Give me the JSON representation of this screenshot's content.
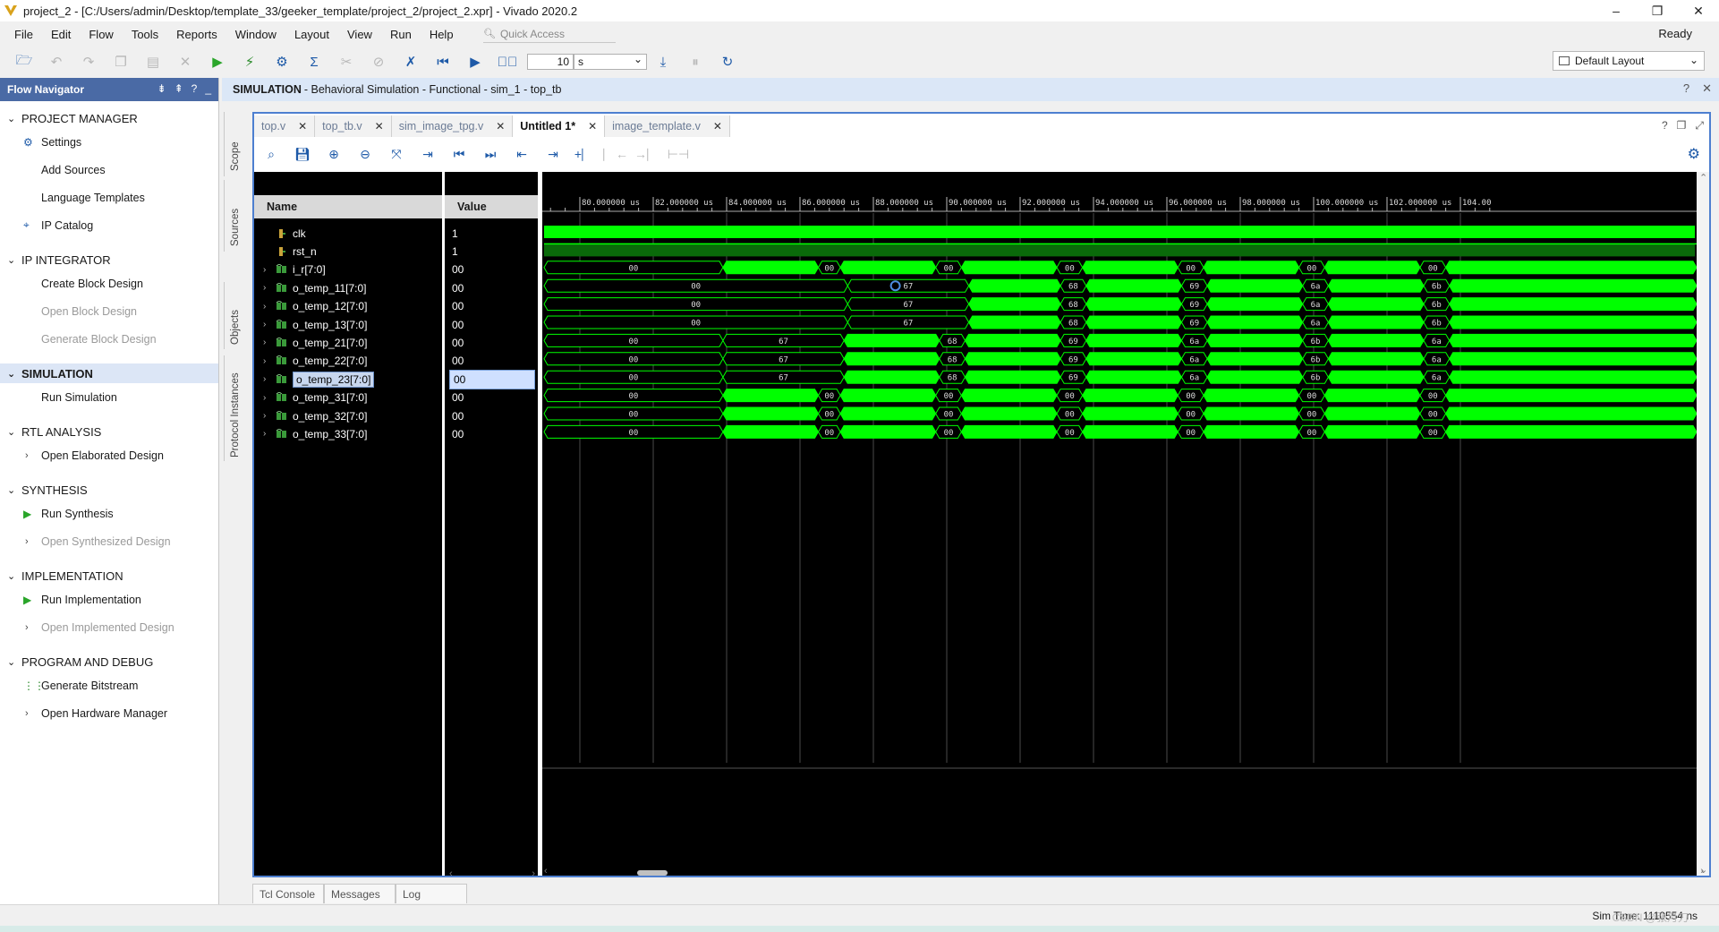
{
  "window": {
    "title": "project_2 - [C:/Users/admin/Desktop/template_33/geeker_template/project_2/project_2.xpr] - Vivado 2020.2",
    "minimize": "–",
    "restore": "❐",
    "close": "✕"
  },
  "menu": [
    "File",
    "Edit",
    "Flow",
    "Tools",
    "Reports",
    "Window",
    "Layout",
    "View",
    "Run",
    "Help"
  ],
  "quick_access_placeholder": "Quick Access",
  "status_ready": "Ready",
  "toolbar": {
    "run_time_value": "10",
    "run_time_unit": "s",
    "layout_label": "Default Layout"
  },
  "flow_navigator": {
    "title": "Flow Navigator",
    "sections": [
      {
        "label": "PROJECT MANAGER",
        "items": [
          {
            "label": "Settings",
            "icon": "gear-icon"
          },
          {
            "label": "Add Sources"
          },
          {
            "label": "Language Templates"
          },
          {
            "label": "IP Catalog",
            "icon": "ip-icon"
          }
        ]
      },
      {
        "label": "IP INTEGRATOR",
        "items": [
          {
            "label": "Create Block Design"
          },
          {
            "label": "Open Block Design",
            "disabled": true
          },
          {
            "label": "Generate Block Design",
            "disabled": true
          }
        ]
      },
      {
        "label": "SIMULATION",
        "active": true,
        "items": [
          {
            "label": "Run Simulation"
          }
        ]
      },
      {
        "label": "RTL ANALYSIS",
        "items": [
          {
            "label": "Open Elaborated Design",
            "expandable": true
          }
        ]
      },
      {
        "label": "SYNTHESIS",
        "items": [
          {
            "label": "Run Synthesis",
            "icon": "play-icon"
          },
          {
            "label": "Open Synthesized Design",
            "expandable": true,
            "disabled": true
          }
        ]
      },
      {
        "label": "IMPLEMENTATION",
        "items": [
          {
            "label": "Run Implementation",
            "icon": "play-icon"
          },
          {
            "label": "Open Implemented Design",
            "expandable": true,
            "disabled": true
          }
        ]
      },
      {
        "label": "PROGRAM AND DEBUG",
        "items": [
          {
            "label": "Generate Bitstream",
            "icon": "bitstream-icon"
          },
          {
            "label": "Open Hardware Manager",
            "expandable": true
          }
        ]
      }
    ]
  },
  "sim_header": {
    "bold": "SIMULATION",
    "text": " - Behavioral Simulation - Functional - sim_1 - top_tb"
  },
  "side_tabs": [
    "Scope",
    "Sources",
    "Objects",
    "Protocol Instances"
  ],
  "editor_tabs": [
    {
      "label": "top.v",
      "active": false
    },
    {
      "label": "top_tb.v",
      "active": false
    },
    {
      "label": "sim_image_tpg.v",
      "active": false
    },
    {
      "label": "Untitled 1*",
      "active": true
    },
    {
      "label": "image_template.v",
      "active": false
    }
  ],
  "wave": {
    "name_header": "Name",
    "value_header": "Value",
    "signals": [
      {
        "name": "clk",
        "value": "1",
        "type": "bit"
      },
      {
        "name": "rst_n",
        "value": "1",
        "type": "bit"
      },
      {
        "name": "i_r[7:0]",
        "value": "00",
        "type": "bus"
      },
      {
        "name": "o_temp_11[7:0]",
        "value": "00",
        "type": "bus"
      },
      {
        "name": "o_temp_12[7:0]",
        "value": "00",
        "type": "bus"
      },
      {
        "name": "o_temp_13[7:0]",
        "value": "00",
        "type": "bus"
      },
      {
        "name": "o_temp_21[7:0]",
        "value": "00",
        "type": "bus"
      },
      {
        "name": "o_temp_22[7:0]",
        "value": "00",
        "type": "bus"
      },
      {
        "name": "o_temp_23[7:0]",
        "value": "00",
        "type": "bus",
        "selected": true
      },
      {
        "name": "o_temp_31[7:0]",
        "value": "00",
        "type": "bus"
      },
      {
        "name": "o_temp_32[7:0]",
        "value": "00",
        "type": "bus"
      },
      {
        "name": "o_temp_33[7:0]",
        "value": "00",
        "type": "bus"
      }
    ],
    "time_labels": [
      "80.000000 us",
      "82.000000 us",
      "84.000000 us",
      "86.000000 us",
      "88.000000 us",
      "90.000000 us",
      "92.000000 us",
      "94.000000 us",
      "96.000000 us",
      "98.000000 us",
      "100.000000 us",
      "102.000000 us",
      "104.00"
    ],
    "bus_labels": {
      "i_r": [
        "00",
        "00",
        "00",
        "00",
        "00",
        "00",
        "00"
      ],
      "o_temp_11": [
        "00",
        "67",
        "68",
        "69",
        "6a",
        "6b"
      ],
      "o_temp_12": [
        "00",
        "67",
        "68",
        "69",
        "6a",
        "6b"
      ],
      "o_temp_13": [
        "00",
        "67",
        "68",
        "69",
        "6a",
        "6b"
      ],
      "o_temp_21": [
        "00",
        "67",
        "68",
        "69",
        "6a",
        "6b",
        "6a"
      ],
      "o_temp_22": [
        "00",
        "67",
        "68",
        "69",
        "6a",
        "6b",
        "6a"
      ],
      "o_temp_23": [
        "00",
        "67",
        "68",
        "69",
        "6a",
        "6b",
        "6a"
      ],
      "o_temp_31": [
        "00",
        "00",
        "00",
        "00",
        "00",
        "00",
        "00"
      ],
      "o_temp_32": [
        "00",
        "00",
        "00",
        "00",
        "00",
        "00",
        "00"
      ],
      "o_temp_33": [
        "00",
        "00",
        "00",
        "00",
        "00",
        "00",
        "00"
      ]
    },
    "colors": {
      "signal": "#00ff00",
      "background": "#000000",
      "grid": "#4a4a4a"
    }
  },
  "bottom_tabs": [
    "Tcl Console",
    "Messages",
    "Log"
  ],
  "status": {
    "sim_time": "Sim Time: 1110554 ns",
    "watermark": "CSDN @张月刀"
  }
}
